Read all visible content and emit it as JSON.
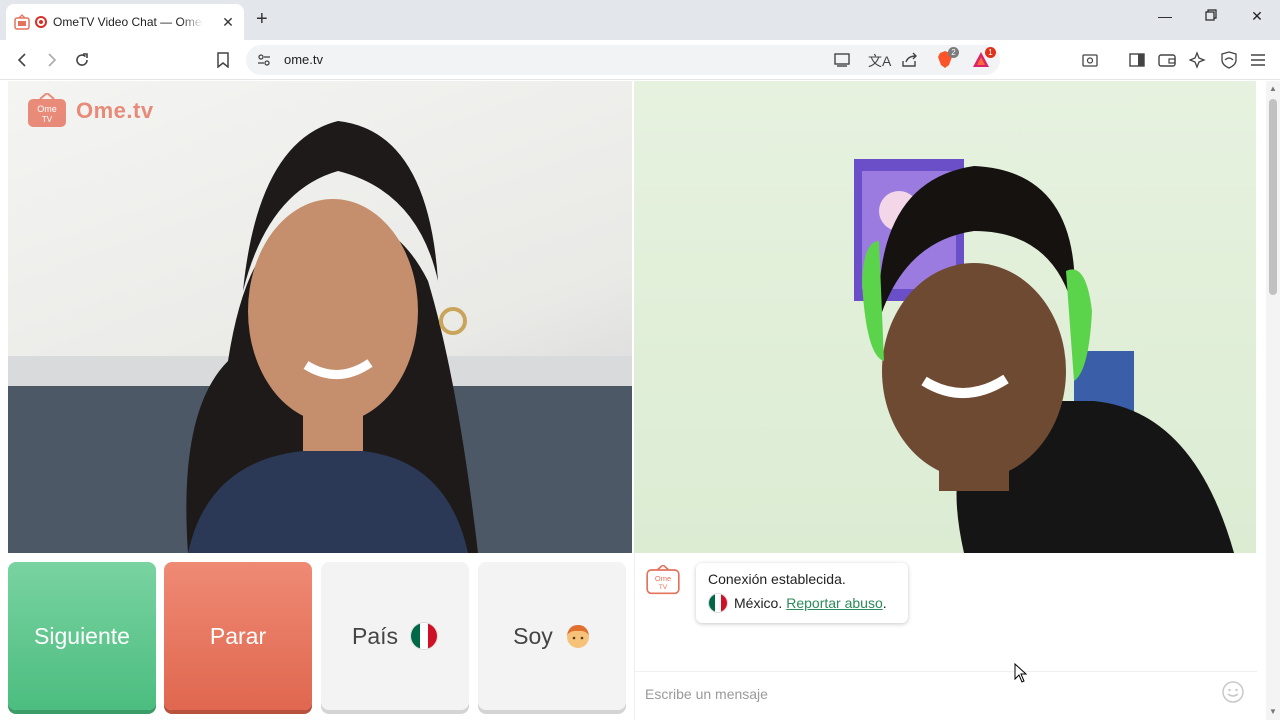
{
  "browser": {
    "tab_title": "OmeTV Video Chat — Omegle",
    "url": "ome.tv",
    "brave_badge": "2",
    "rewards_badge": "1"
  },
  "page": {
    "logo_text": "Ome.tv",
    "logo_mark_text": "Ome TV",
    "buttons": {
      "next": "Siguiente",
      "stop": "Parar",
      "country": "País",
      "gender": "Soy"
    },
    "chat": {
      "status": "Conexión establecida.",
      "country": "México.",
      "report_link": "Reportar abuso",
      "report_suffix": ".",
      "placeholder": "Escribe un mensaje"
    }
  },
  "colors": {
    "next_button": "#5cc48a",
    "stop_button": "#e87660",
    "link": "#2d8a5a",
    "flag_green": "#006847",
    "flag_red": "#ce1126"
  },
  "icons": [
    "back-icon",
    "forward-icon",
    "reload-icon",
    "bookmark-icon",
    "site-info-icon",
    "cast-icon",
    "translate-icon",
    "share-icon",
    "brave-shields-icon",
    "brave-rewards-icon",
    "search-tabs-icon",
    "sidebar-icon",
    "wallet-icon",
    "leo-ai-icon",
    "vpn-icon",
    "menu-icon",
    "emoji-icon"
  ]
}
